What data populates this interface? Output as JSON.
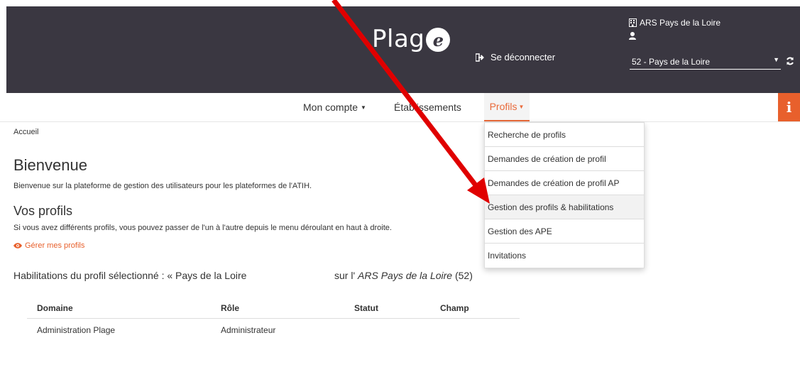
{
  "header": {
    "logo_text": "Plag",
    "logo_letter": "e",
    "logout_label": "Se déconnecter",
    "organization": "ARS Pays de la Loire",
    "region_select_value": "52 - Pays de la Loire"
  },
  "nav": {
    "items": [
      {
        "label": "Mon compte"
      },
      {
        "label": "Établissements"
      },
      {
        "label": "Profils"
      }
    ],
    "info_label": "i"
  },
  "dropdown": {
    "items": [
      {
        "label": "Recherche de profils"
      },
      {
        "label": "Demandes de création de profil"
      },
      {
        "label": "Demandes de création de profil AP"
      },
      {
        "label": "Gestion des profils & habilitations"
      },
      {
        "label": "Gestion des APE"
      },
      {
        "label": "Invitations"
      }
    ]
  },
  "content": {
    "breadcrumb": "Accueil",
    "welcome_title": "Bienvenue",
    "welcome_text": "Bienvenue sur la plateforme de gestion des utilisateurs pour les plateformes de l'ATIH.",
    "profiles_title": "Vos profils",
    "profiles_text": "Si vous avez différents profils, vous pouvez passer de l'un à l'autre depuis le menu déroulant en haut à droite.",
    "manage_link": "Gérer mes profils",
    "habilitations_title": "Habilitations du profil sélectionné : « Pays de la Loire",
    "habilitations_on": "sur l'",
    "habilitations_org": "ARS Pays de la Loire",
    "habilitations_code": "(52)"
  },
  "table": {
    "headers": [
      "Domaine",
      "Rôle",
      "Statut",
      "Champ"
    ],
    "rows": [
      [
        "Administration Plage",
        "Administrateur",
        "",
        ""
      ]
    ]
  },
  "colors": {
    "header_bg": "#3a3741",
    "accent": "#e8602c",
    "arrow": "#e00000"
  }
}
